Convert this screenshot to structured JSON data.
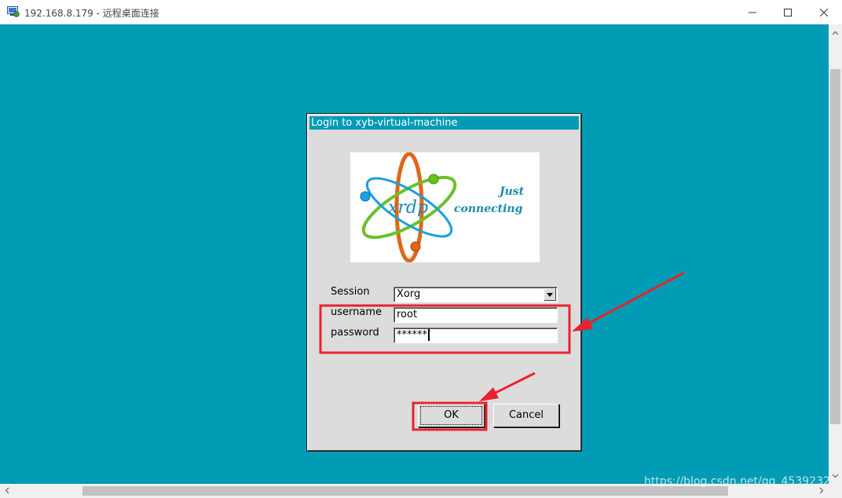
{
  "window": {
    "title": "192.168.8.179 - 远程桌面连接",
    "controls": [
      "minimize-icon",
      "maximize-icon",
      "close-icon"
    ]
  },
  "dialog": {
    "title": "Login to xyb-virtual-machine",
    "logo": {
      "text": "xrdp",
      "tagline_1": "Just",
      "tagline_2": "connecting"
    },
    "session_label": "Session",
    "session_value": "Xorg",
    "username_label": "username",
    "username_value": "root",
    "password_label": "password",
    "password_value": "******",
    "ok_label": "OK",
    "cancel_label": "Cancel"
  },
  "watermark": "https://blog.csdn.net/qq_4539232",
  "colors": {
    "desktop": "#009bb4",
    "dialog": "#dcdcdc",
    "annotation": "#e8232e"
  }
}
